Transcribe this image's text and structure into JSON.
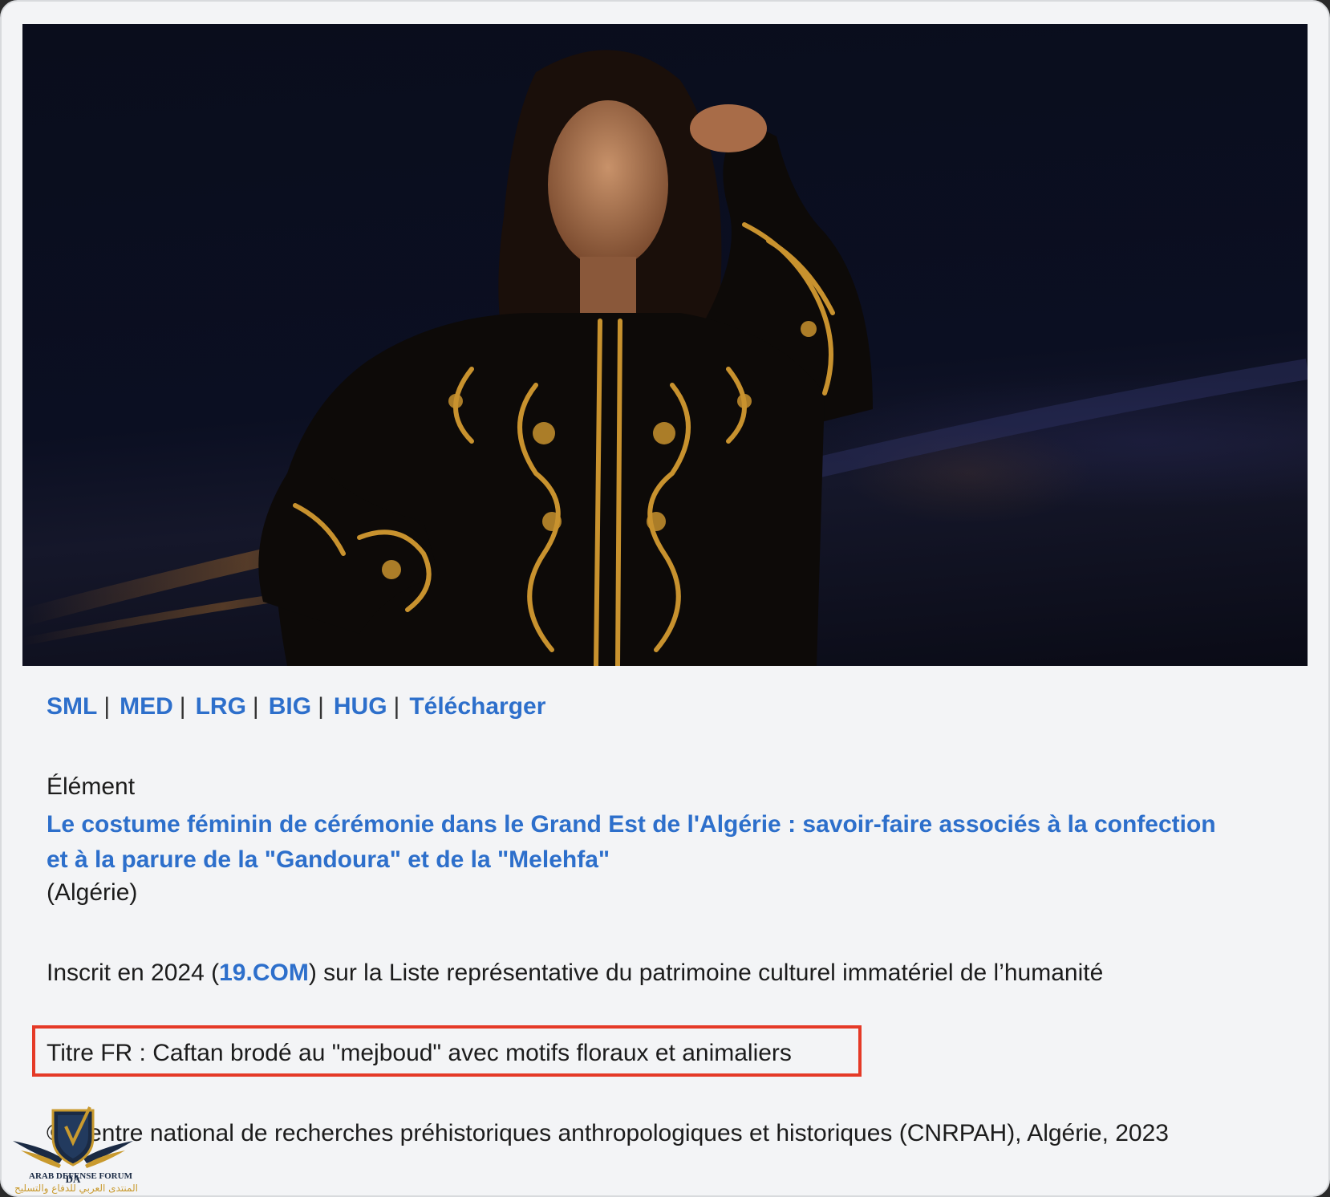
{
  "photo": {
    "subject": "woman-in-embroidered-caftan",
    "colors": {
      "background": "#0b0f22",
      "gold": "#c8922e",
      "garment": "#0d0a08"
    }
  },
  "size_links": [
    "SML",
    "MED",
    "LRG",
    "BIG",
    "HUG",
    "Télécharger"
  ],
  "size_separator": "|",
  "element": {
    "label": "Élément",
    "title": "Le costume féminin de cérémonie dans le Grand Est de l'Algérie : savoir-faire associés à la confection et à la parure de la \"Gandoura\" et de la \"Melehfa\"",
    "country": "(Algérie)"
  },
  "inscription": {
    "prefix": "Inscrit en 2024 (",
    "link": "19.COM",
    "suffix": ") sur la Liste représentative du patrimoine culturel immatériel de l’humanité"
  },
  "title_fr": "Titre FR : Caftan brodé au \"mejboud\" avec motifs floraux et animaliers",
  "credit": "© Centre national de recherches préhistoriques anthropologiques et historiques (CNRPAH), Algérie, 2023",
  "watermark": {
    "line1": "ARAB DEFENSE FORUM",
    "line2": "المنتدى العربي للدفاع والتسليح",
    "monogram": "DA"
  },
  "accent_colors": {
    "link": "#2d6fcb",
    "highlight_box": "#e53a27"
  }
}
